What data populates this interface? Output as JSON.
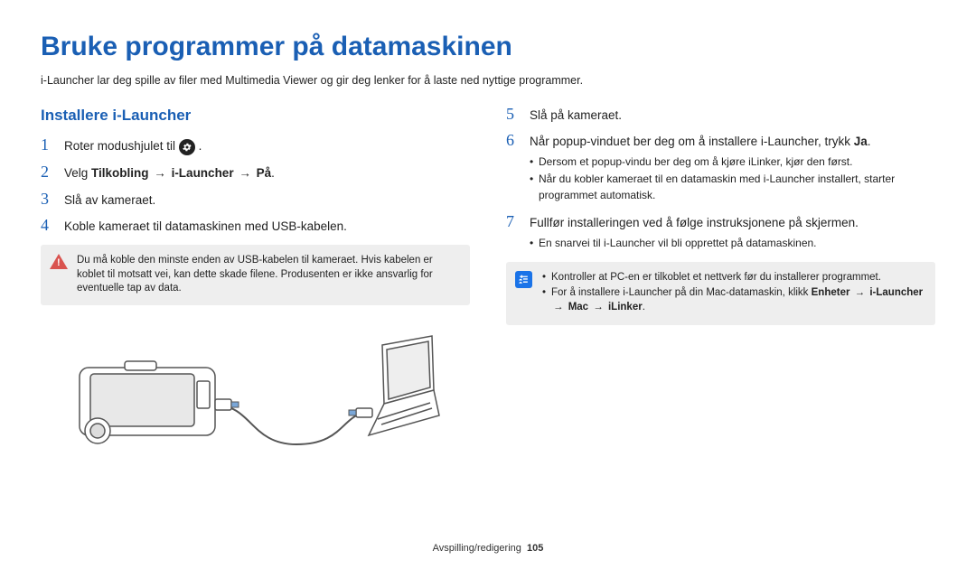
{
  "title": "Bruke programmer på datamaskinen",
  "intro": "i-Launcher lar deg spille av filer med Multimedia Viewer og gir deg lenker for å laste ned nyttige programmer.",
  "section_heading": "Installere i-Launcher",
  "left_steps": {
    "s1_a": "Roter modushjulet til ",
    "s1_b": ".",
    "s2_a": "Velg ",
    "s2_b1": "Tilkobling",
    "s2_b2": "i-Launcher",
    "s2_b3": "På",
    "s2_c": ".",
    "s3": "Slå av kameraet.",
    "s4": "Koble kameraet til datamaskinen med USB-kabelen."
  },
  "warn_note": "Du må koble den minste enden av USB-kabelen til kameraet. Hvis kabelen er koblet til motsatt vei, kan dette skade filene. Produsenten er ikke ansvarlig for eventuelle tap av data.",
  "right_steps": {
    "s5": "Slå på kameraet.",
    "s6_a": "Når popup-vinduet ber deg om å installere i-Launcher, trykk ",
    "s6_b": "Ja",
    "s6_c": ".",
    "s6_sub1": "Dersom et popup-vindu ber deg om å kjøre iLinker, kjør den først.",
    "s6_sub2": "Når du kobler kameraet til en datamaskin med i-Launcher installert, starter programmet automatisk.",
    "s7": "Fullfør installeringen ved å følge instruksjonene på skjermen.",
    "s7_sub1": "En snarvei til i-Launcher vil bli opprettet på datamaskinen."
  },
  "info_note": {
    "li1": "Kontroller at PC-en er tilkoblet et nettverk før du installerer programmet.",
    "li2_a": "For å installere i-Launcher på din Mac-datamaskin, klikk ",
    "li2_b1": "Enheter",
    "li2_b2": "i-Launcher",
    "li2_b3": "Mac",
    "li2_b4": "iLinker",
    "li2_c": "."
  },
  "footer_section": "Avspilling/redigering",
  "footer_page": "105"
}
